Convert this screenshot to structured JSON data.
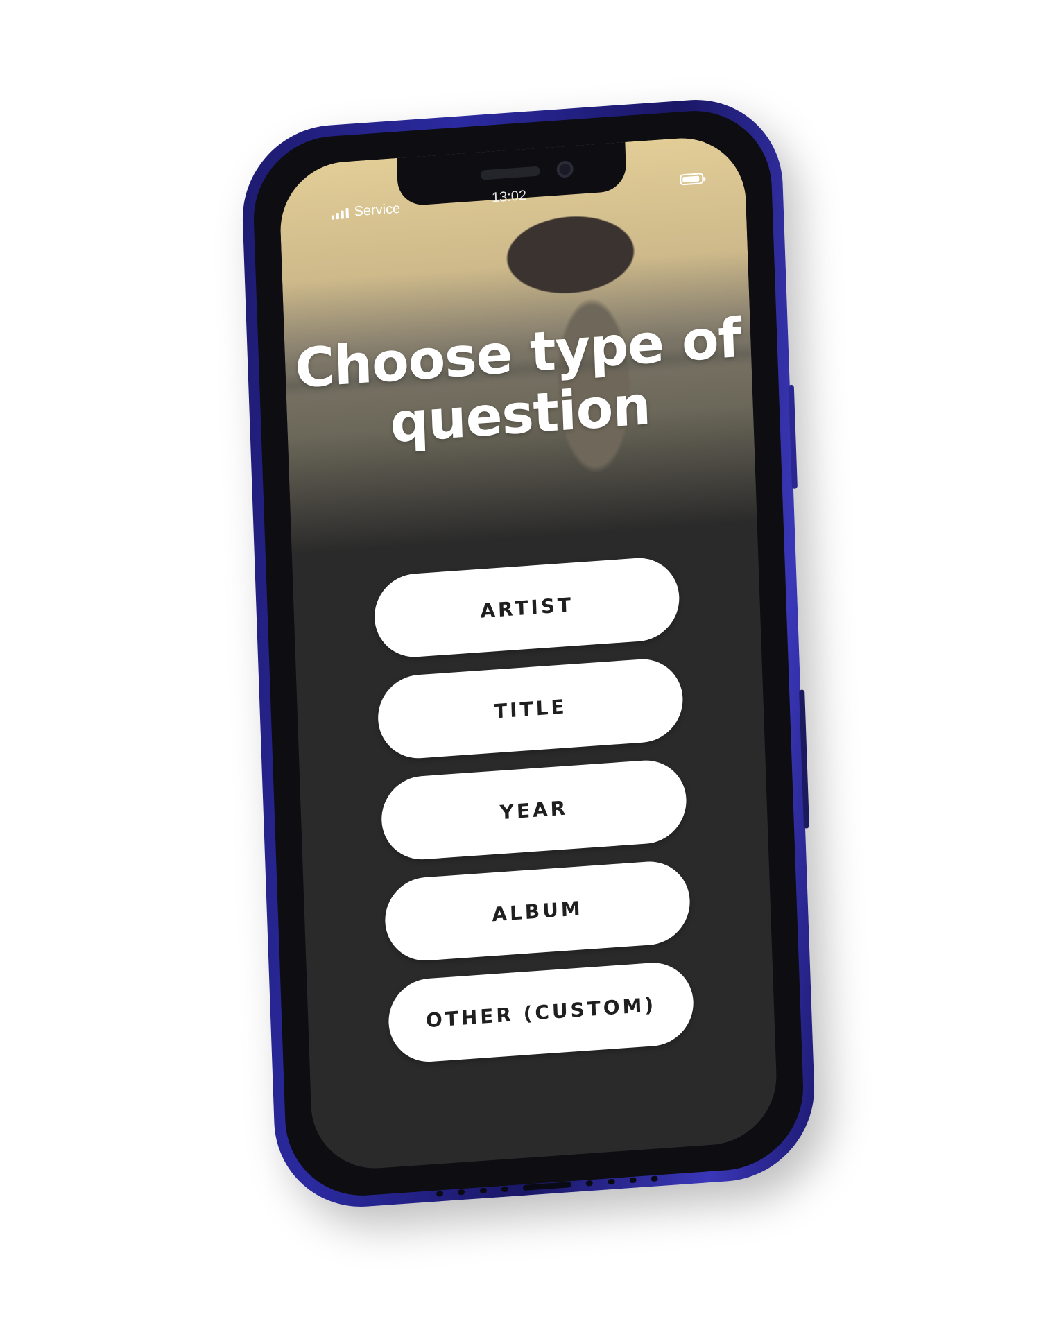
{
  "status_bar": {
    "carrier": "Service",
    "time": "13:02"
  },
  "screen": {
    "title": "Choose type of question"
  },
  "options": [
    {
      "label": "ARTIST"
    },
    {
      "label": "TITLE"
    },
    {
      "label": "YEAR"
    },
    {
      "label": "ALBUM"
    },
    {
      "label": "OTHER (CUSTOM)"
    }
  ],
  "colors": {
    "frame": "#2b2aa0",
    "screen_background": "#2a2a2a",
    "hero_sand": "#e2cd97",
    "button_background": "#ffffff",
    "button_text": "#1f1f1f"
  }
}
